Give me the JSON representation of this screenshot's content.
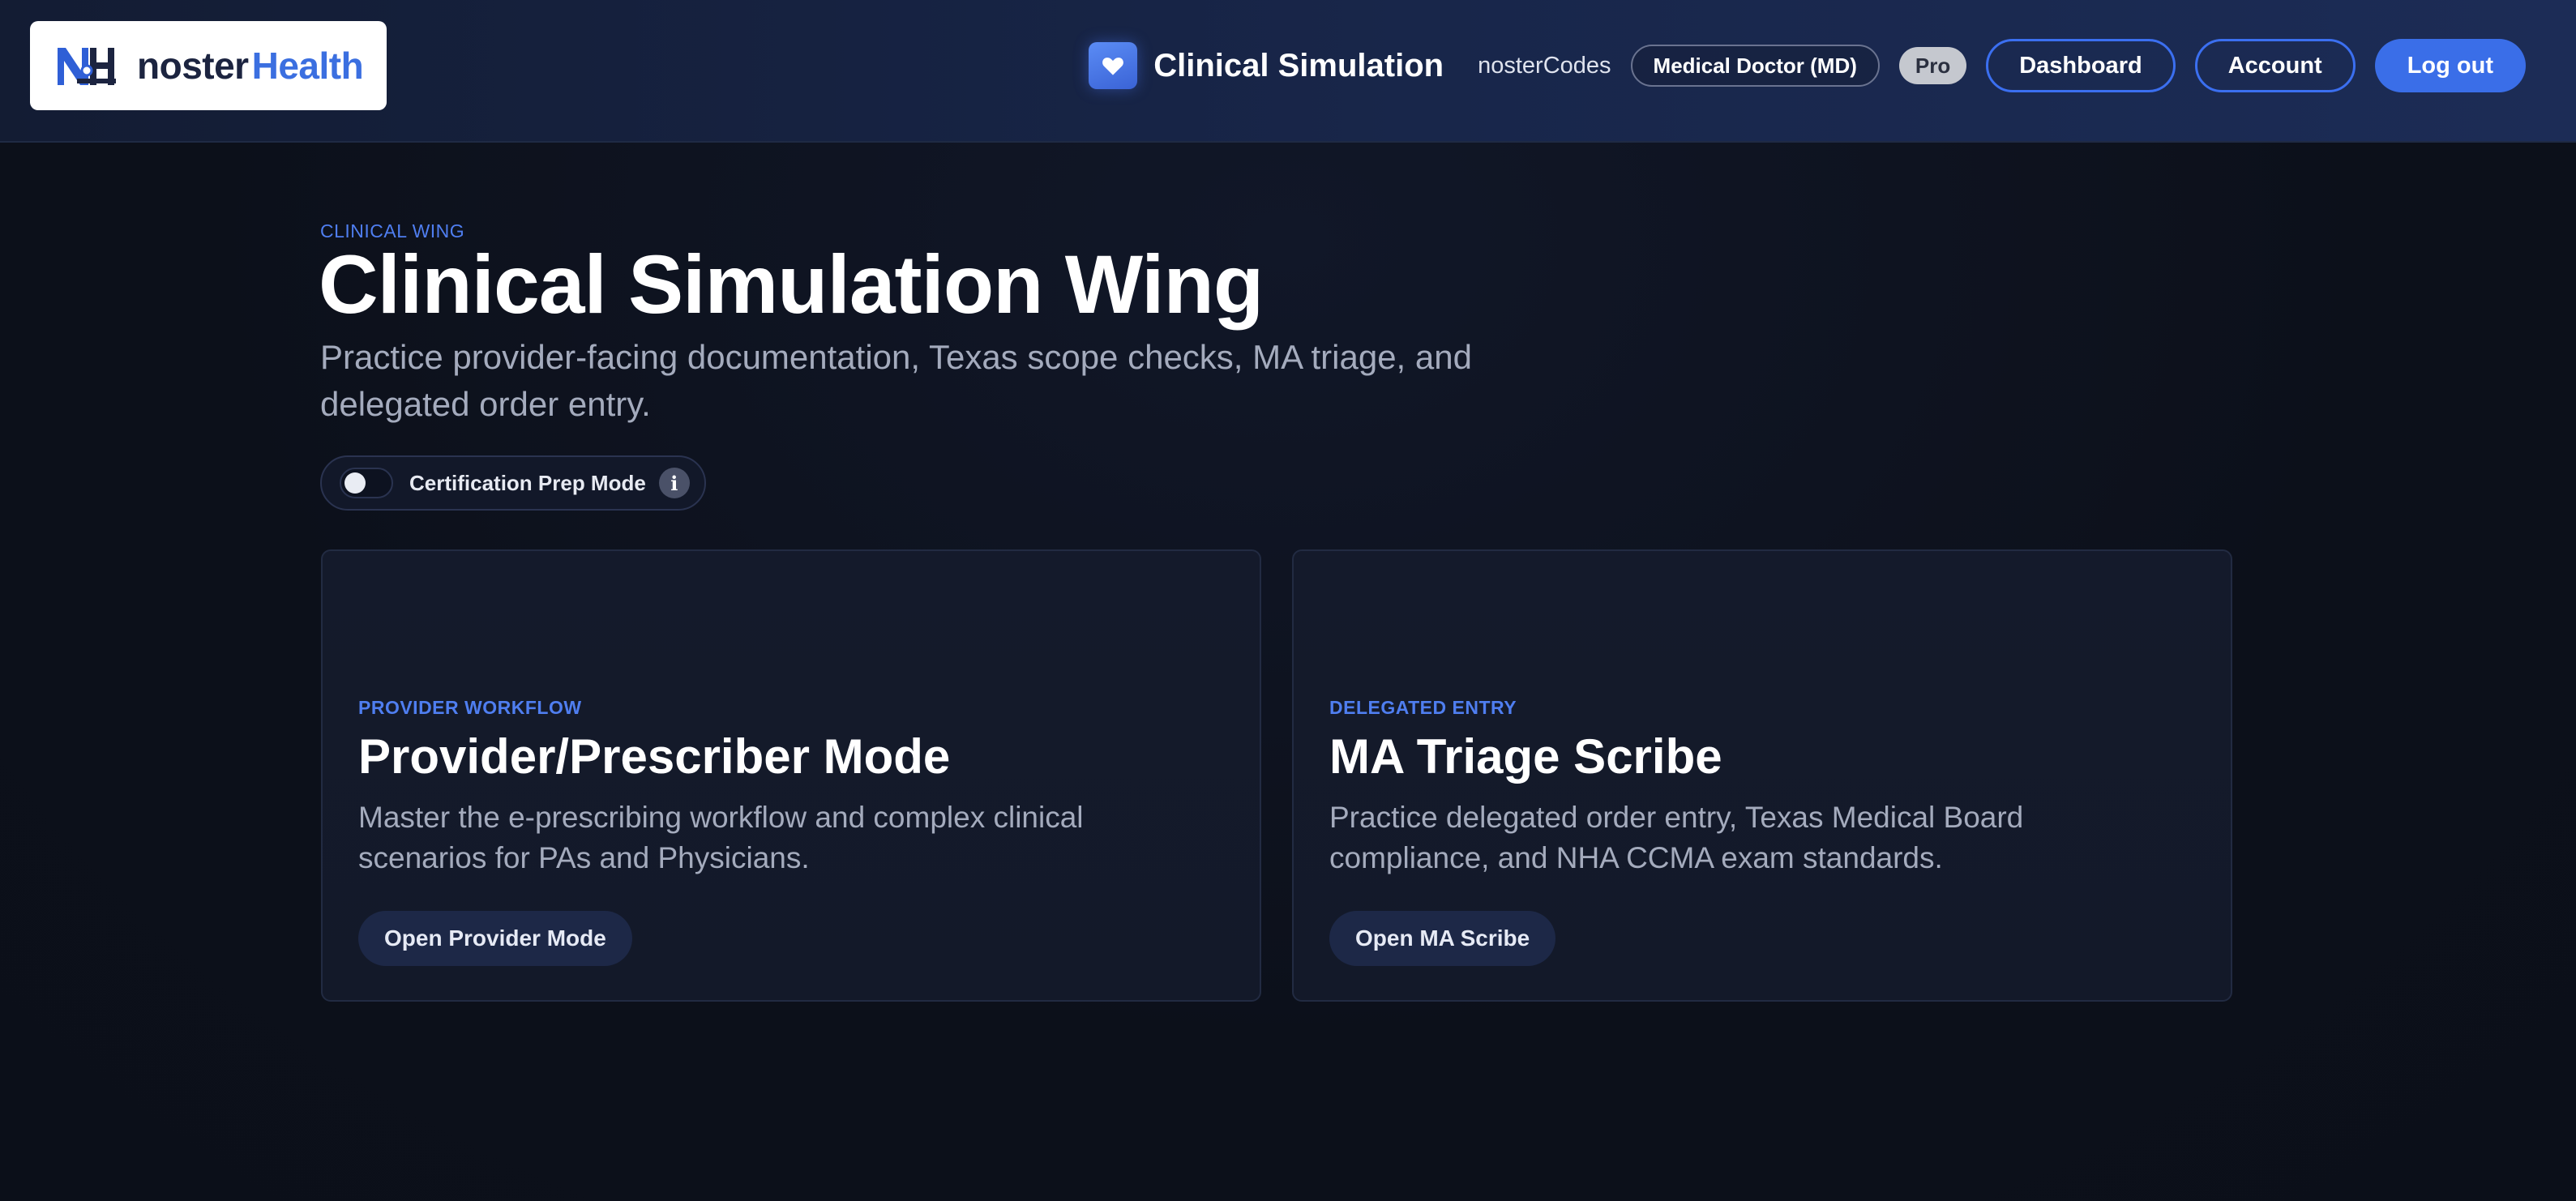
{
  "header": {
    "logo": {
      "word_a": "noster",
      "word_b": "Health",
      "mark_icon": "nh-logo-mark"
    },
    "app": {
      "icon": "heart-icon",
      "title": "Clinical Simulation"
    },
    "user_name": "nosterCodes",
    "role_badge": "Medical Doctor (MD)",
    "plan_badge": "Pro",
    "dashboard_label": "Dashboard",
    "account_label": "Account",
    "logout_label": "Log out"
  },
  "hero": {
    "eyebrow": "CLINICAL WING",
    "title": "Clinical Simulation Wing",
    "subtitle": "Practice provider-facing documentation, Texas scope checks, MA triage, and delegated order entry.",
    "cert_mode": {
      "label": "Certification Prep Mode",
      "enabled": false,
      "info_glyph": "i"
    }
  },
  "cards": [
    {
      "eyebrow": "PROVIDER WORKFLOW",
      "title": "Provider/Prescriber Mode",
      "description": "Master the e-prescribing workflow and complex clinical scenarios for PAs and Physicians.",
      "button": "Open Provider Mode"
    },
    {
      "eyebrow": "DELEGATED ENTRY",
      "title": "MA Triage Scribe",
      "description": "Practice delegated order entry, Texas Medical Board compliance, and NHA CCMA exam standards.",
      "button": "Open MA Scribe"
    }
  ],
  "colors": {
    "accent": "#3a6ee8",
    "eyebrow": "#4f7ef0",
    "background": "#0d111c",
    "header": "#18264a",
    "card": "#141a2b"
  }
}
